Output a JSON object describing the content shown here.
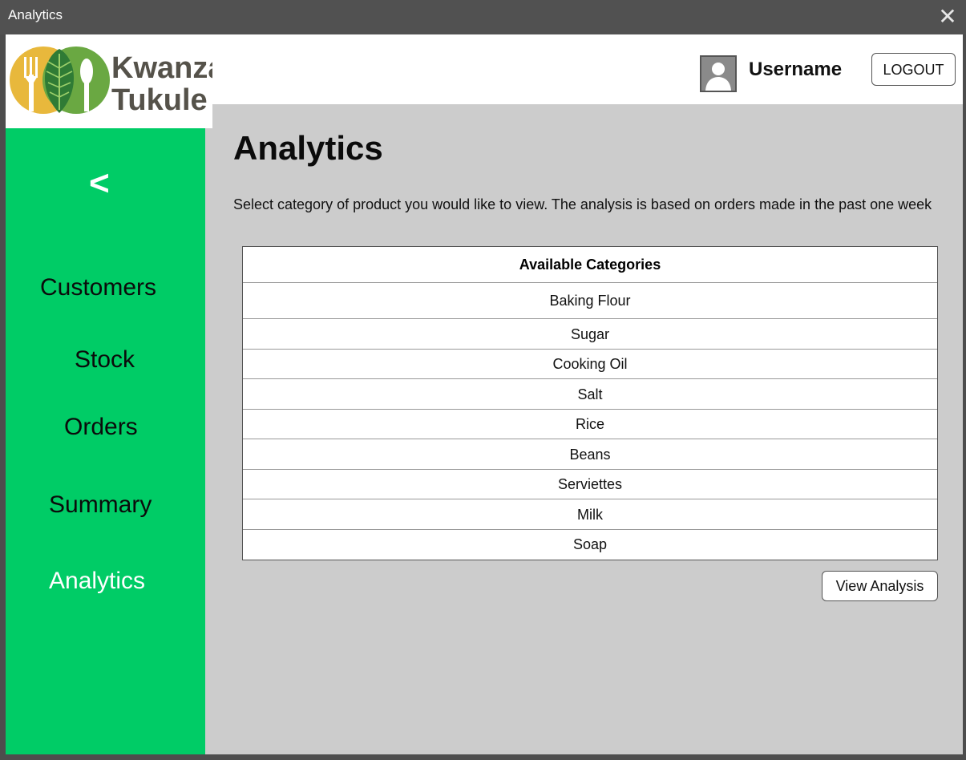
{
  "window": {
    "title": "Analytics"
  },
  "logo": {
    "line1": "Kwanza",
    "line2": "Tukule"
  },
  "header": {
    "username": "Username",
    "logout_label": "LOGOUT"
  },
  "sidebar": {
    "back_label": "<",
    "items": [
      {
        "label": "Customers",
        "active": false
      },
      {
        "label": "Stock",
        "active": false
      },
      {
        "label": "Orders",
        "active": false
      },
      {
        "label": "Summary",
        "active": false
      },
      {
        "label": "Analytics",
        "active": true
      }
    ]
  },
  "main": {
    "heading": "Analytics",
    "description": "Select category of product you would like to view.  The analysis is based on orders made in the past one week",
    "table": {
      "header": "Available Categories",
      "rows": [
        "Baking Flour",
        "Sugar",
        "Cooking Oil",
        "Salt",
        "Rice",
        "Beans",
        "Serviettes",
        "Milk",
        "Soap"
      ]
    },
    "view_button_label": "View Analysis"
  },
  "colors": {
    "sidebar": "#00cc66",
    "content_bg": "#cccccc",
    "titlebar": "#515151",
    "logo_yellow": "#e8b83c",
    "logo_green": "#5a9e38"
  }
}
